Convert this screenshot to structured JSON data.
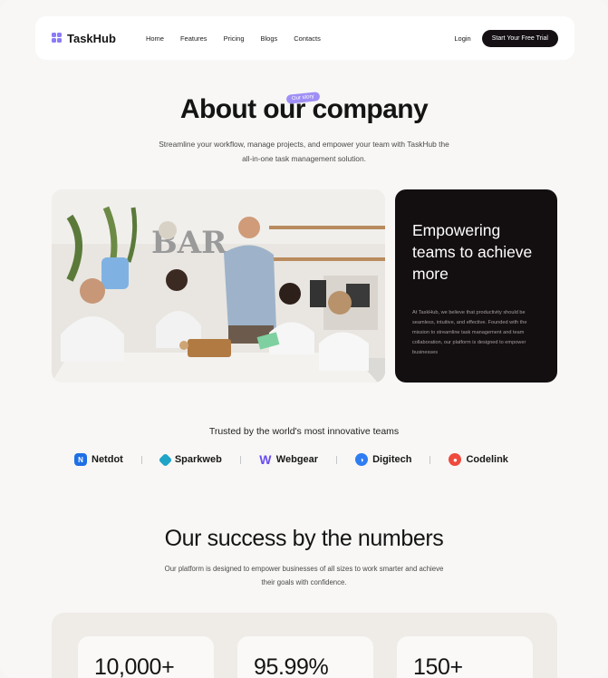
{
  "nav": {
    "logo": "TaskHub",
    "links": [
      "Home",
      "Features",
      "Pricing",
      "Blogs",
      "Contacts"
    ],
    "login": "Login",
    "cta": "Start Your Free Trial"
  },
  "hero": {
    "badge": "Our story",
    "title": "About our company",
    "subtitle": "Streamline your workflow, manage projects, and empower your team with TaskHub the all-in-one task management solution."
  },
  "mission": {
    "heading": "Empowering teams to achieve more",
    "body": "At TaskHub, we believe that productivity should be seamless, intuitive, and effective. Founded with the mission to streamline task management and team collaboration, our platform is designed to empower businesses"
  },
  "trusted": {
    "title": "Trusted by the world's most innovative teams",
    "brands": [
      {
        "name": "Netdot",
        "icon": "netdot-logo",
        "color": "#1f6fe5"
      },
      {
        "name": "Sparkweb",
        "icon": "sparkweb-logo",
        "color": "#1fa4c8"
      },
      {
        "name": "Webgear",
        "icon": "webgear-logo",
        "color": "#6a4cf0"
      },
      {
        "name": "Digitech",
        "icon": "digitech-logo",
        "color": "#2f7df2"
      },
      {
        "name": "Codelink",
        "icon": "codelink-logo",
        "color": "#ef4a3d"
      }
    ]
  },
  "stats": {
    "title": "Our success by the numbers",
    "subtitle": "Our platform is designed to empower businesses of all sizes to work smarter and achieve their goals with confidence.",
    "values": [
      "10,000+",
      "95.99%",
      "150+"
    ]
  }
}
